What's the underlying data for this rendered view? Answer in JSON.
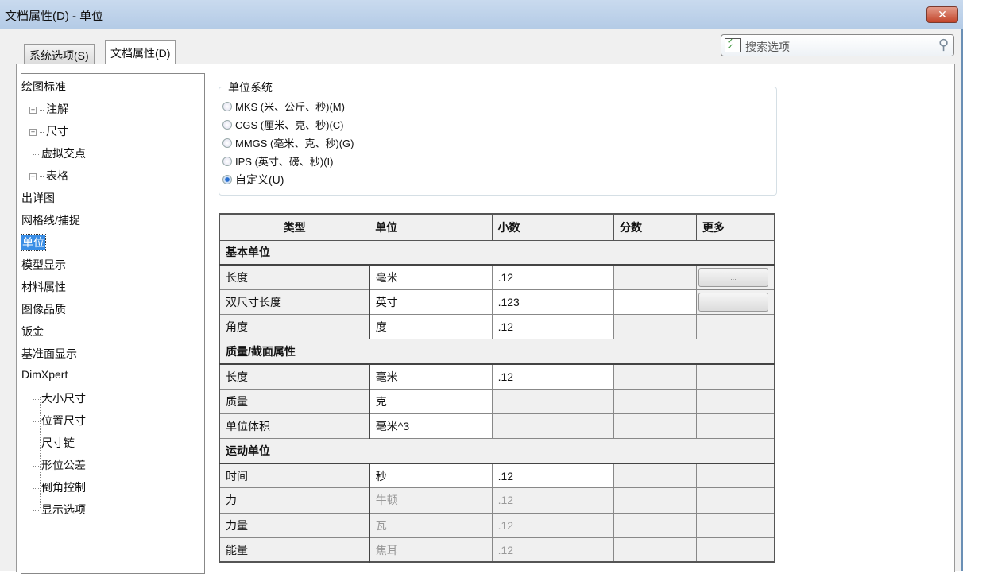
{
  "window": {
    "title": "文档属性(D) - 单位",
    "close": "✕"
  },
  "tabs": [
    {
      "label": "系统选项(S)"
    },
    {
      "label": "文档属性(D)"
    }
  ],
  "search": {
    "placeholder": "搜索选项"
  },
  "tree": [
    {
      "label": "绘图标准"
    },
    {
      "label": "注解"
    },
    {
      "label": "尺寸"
    },
    {
      "label": "虚拟交点"
    },
    {
      "label": "表格"
    },
    {
      "label": "出详图"
    },
    {
      "label": "网格线/捕捉"
    },
    {
      "label": "单位"
    },
    {
      "label": "模型显示"
    },
    {
      "label": "材料属性"
    },
    {
      "label": "图像品质"
    },
    {
      "label": "钣金"
    },
    {
      "label": "基准面显示"
    },
    {
      "label": "DimXpert"
    },
    {
      "label": "大小尺寸"
    },
    {
      "label": "位置尺寸"
    },
    {
      "label": "尺寸链"
    },
    {
      "label": "形位公差"
    },
    {
      "label": "倒角控制"
    },
    {
      "label": "显示选项"
    }
  ],
  "unit_system": {
    "label": "单位系统",
    "options": [
      {
        "label": "MKS (米、公斤、秒)(M)",
        "checked": false
      },
      {
        "label": "CGS (厘米、克、秒)(C)",
        "checked": false
      },
      {
        "label": "MMGS (毫米、克、秒)(G)",
        "checked": false
      },
      {
        "label": "IPS (英寸、磅、秒)(I)",
        "checked": false
      },
      {
        "label": "自定义(U)",
        "checked": true
      }
    ]
  },
  "table": {
    "headers": [
      "类型",
      "单位",
      "小数",
      "分数",
      "更多"
    ],
    "more_label": "...",
    "rows": [
      {
        "section": "基本单位"
      },
      {
        "type": "长度",
        "unit": "毫米",
        "decimal": ".12",
        "fraction": "",
        "more": true
      },
      {
        "type": "双尺寸长度",
        "unit": "英寸",
        "decimal": ".123",
        "fraction": "",
        "more": true
      },
      {
        "type": "角度",
        "unit": "度",
        "decimal": ".12",
        "fraction": ""
      },
      {
        "section": "质量/截面属性"
      },
      {
        "type": "长度",
        "unit": "毫米",
        "decimal": ".12",
        "fraction": ""
      },
      {
        "type": "质量",
        "unit": "克",
        "decimal": "",
        "fraction": ""
      },
      {
        "type": "单位体积",
        "unit": "毫米^3",
        "decimal": "",
        "fraction": ""
      },
      {
        "section": "运动单位"
      },
      {
        "type": "时间",
        "unit": "秒",
        "decimal": ".12",
        "fraction": ""
      },
      {
        "type": "力",
        "unit": "牛顿",
        "decimal": ".12",
        "fraction": "",
        "disabled": true
      },
      {
        "type": "力量",
        "unit": "瓦",
        "decimal": ".12",
        "fraction": "",
        "disabled": true
      },
      {
        "type": "能量",
        "unit": "焦耳",
        "decimal": ".12",
        "fraction": "",
        "disabled": true
      }
    ]
  }
}
